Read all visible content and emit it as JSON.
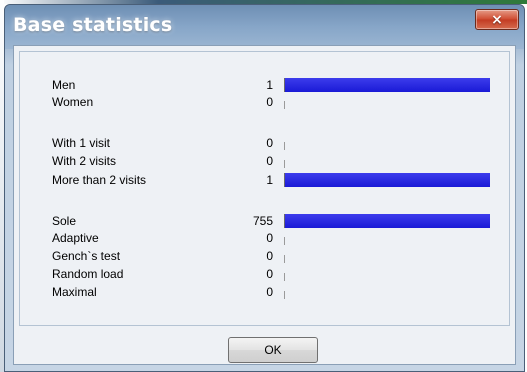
{
  "window": {
    "title": "Base statistics",
    "close_glyph": "×"
  },
  "stats": [
    {
      "label": "Men",
      "value": "1",
      "fraction": 1.0
    },
    {
      "label": "Women",
      "value": "0",
      "fraction": 0.0
    },
    {
      "label": "With 1 visit",
      "value": "0",
      "fraction": 0.0
    },
    {
      "label": "With 2 visits",
      "value": "0",
      "fraction": 0.0
    },
    {
      "label": "More than 2 visits",
      "value": "1",
      "fraction": 1.0
    },
    {
      "label": "Sole",
      "value": "755",
      "fraction": 1.0
    },
    {
      "label": "Adaptive",
      "value": "0",
      "fraction": 0.0
    },
    {
      "label": "Gench`s test",
      "value": "0",
      "fraction": 0.0
    },
    {
      "label": "Random load",
      "value": "0",
      "fraction": 0.0
    },
    {
      "label": "Maximal",
      "value": "0",
      "fraction": 0.0
    }
  ],
  "buttons": {
    "ok_label": "OK"
  },
  "colors": {
    "bar": "#1a1ad6",
    "title_text": "#ffffff",
    "close_button": "#c94a30"
  },
  "icons": {
    "close": "close-icon"
  }
}
